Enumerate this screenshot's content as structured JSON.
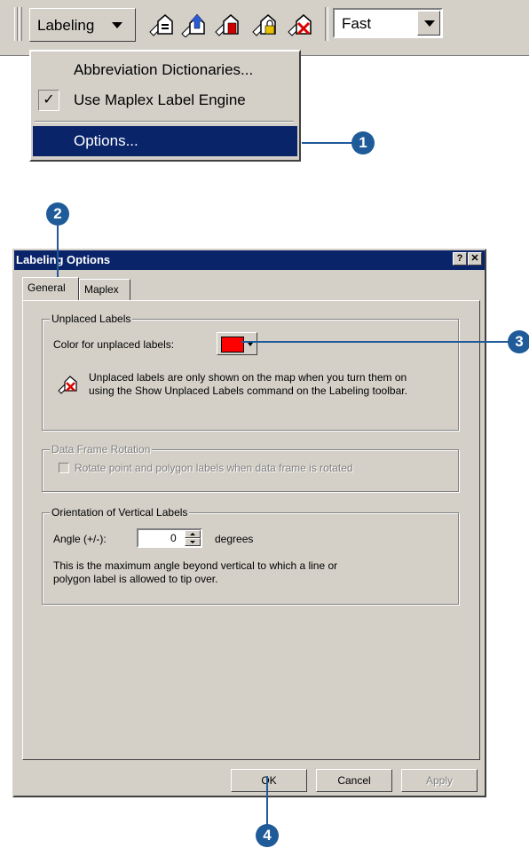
{
  "toolbar": {
    "labeling_label": "Labeling",
    "icons": [
      "label-manager-icon",
      "label-priority-icon",
      "label-weight-icon",
      "lock-labels-icon",
      "view-unplaced-labels-icon"
    ],
    "speed_value": "Fast"
  },
  "menu": {
    "items": [
      {
        "label": "Abbreviation Dictionaries...",
        "checked": false,
        "selected": false
      },
      {
        "label": "Use Maplex Label Engine",
        "checked": true,
        "selected": false
      },
      {
        "label": "Options...",
        "checked": false,
        "selected": true
      }
    ],
    "check_glyph": "✓"
  },
  "dialog": {
    "title": "Labeling Options",
    "help_btn": "?",
    "close_btn": "✕",
    "tabs": [
      "General",
      "Maplex"
    ],
    "active_tab": "General",
    "unplaced": {
      "legend": "Unplaced Labels",
      "color_label": "Color for unplaced labels:",
      "color_value": "#ff0000",
      "note_line1": "Unplaced labels are only shown on the map when you turn them on",
      "note_line2": "using the Show Unplaced Labels command on the Labeling toolbar."
    },
    "rotation": {
      "legend": "Data Frame Rotation",
      "checkbox_label": "Rotate point and polygon labels when data frame is rotated",
      "checked": false
    },
    "vertical": {
      "legend": "Orientation of Vertical Labels",
      "angle_label": "Angle (+/-):",
      "angle_value": "0",
      "unit": "degrees",
      "desc_line1": "This is the maximum angle beyond vertical to which a line or",
      "desc_line2": "polygon label is allowed to tip over."
    },
    "buttons": {
      "ok": "OK",
      "cancel": "Cancel",
      "apply": "Apply"
    }
  },
  "callouts": [
    "1",
    "2",
    "3",
    "4"
  ],
  "colors": {
    "callout": "#1f5a99",
    "titlebar": "#0a246a",
    "face": "#d4d0c8"
  }
}
